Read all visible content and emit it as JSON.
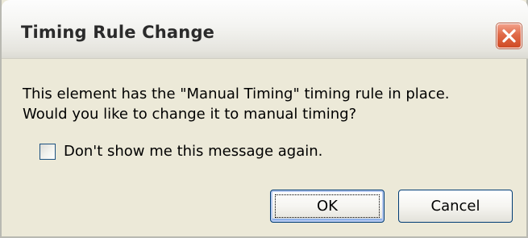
{
  "dialog": {
    "title": "Timing Rule Change",
    "close_icon": "close-icon",
    "message_line1": "This element has the \"Manual Timing\" timing rule in place.",
    "message_line2": "Would you like to change it to manual timing?",
    "checkbox": {
      "label": "Don't show me this message again.",
      "checked": false
    },
    "buttons": {
      "ok_label": "OK",
      "cancel_label": "Cancel"
    }
  }
}
